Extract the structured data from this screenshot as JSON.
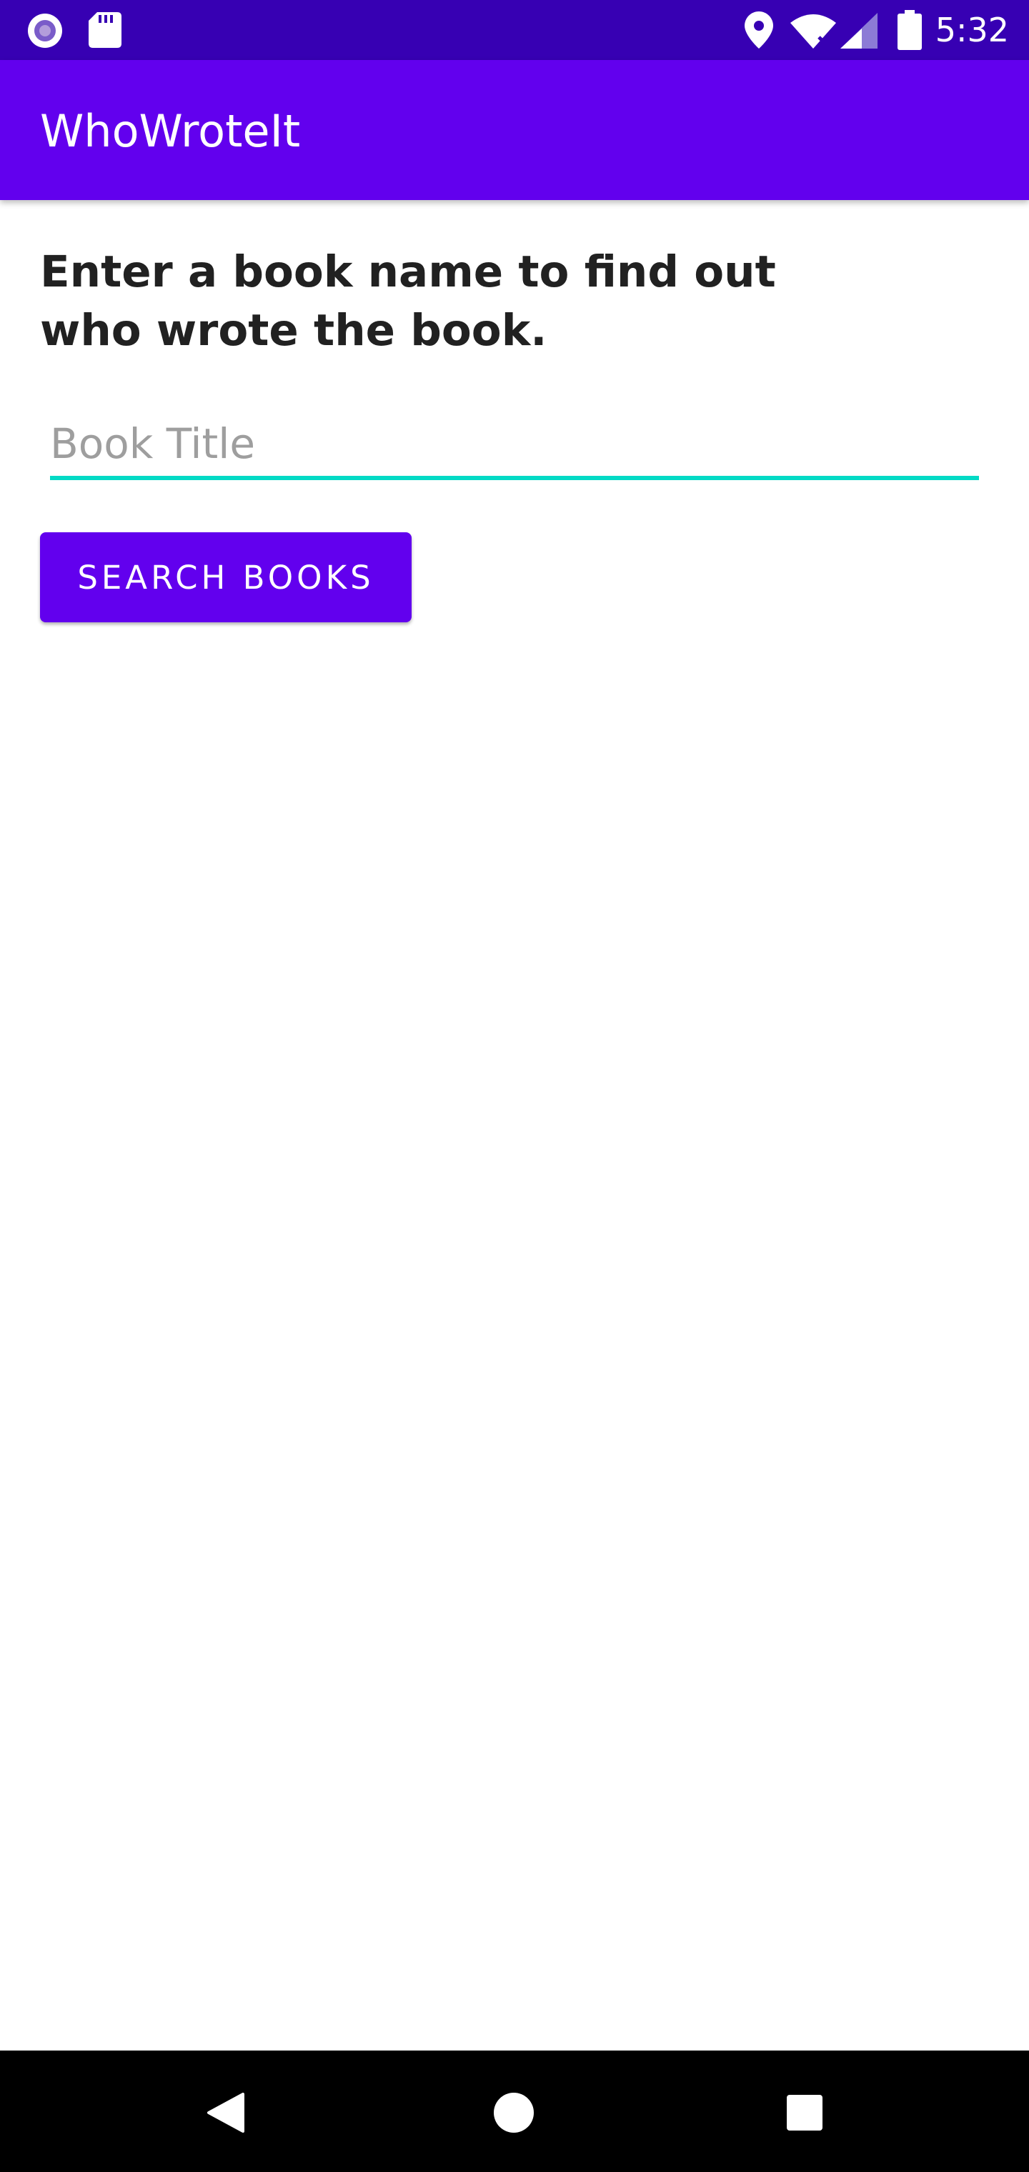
{
  "status_bar": {
    "time": "5:32",
    "icons": [
      "record-icon",
      "sd-card-icon",
      "location-icon",
      "wifi-icon",
      "signal-icon",
      "battery-icon"
    ],
    "background_color": "#3700b3"
  },
  "app_bar": {
    "title": "WhoWroteIt",
    "background_color": "#6200ee"
  },
  "main": {
    "instructions": "Enter a book name to find out who wrote the book.",
    "book_input": {
      "value": "",
      "placeholder": "Book Title",
      "underline_color": "#03dac5"
    },
    "search_button": {
      "label": "Search Books",
      "background_color": "#6200ee"
    }
  },
  "nav_bar": {
    "buttons": [
      "back-icon",
      "home-icon",
      "recents-icon"
    ]
  }
}
